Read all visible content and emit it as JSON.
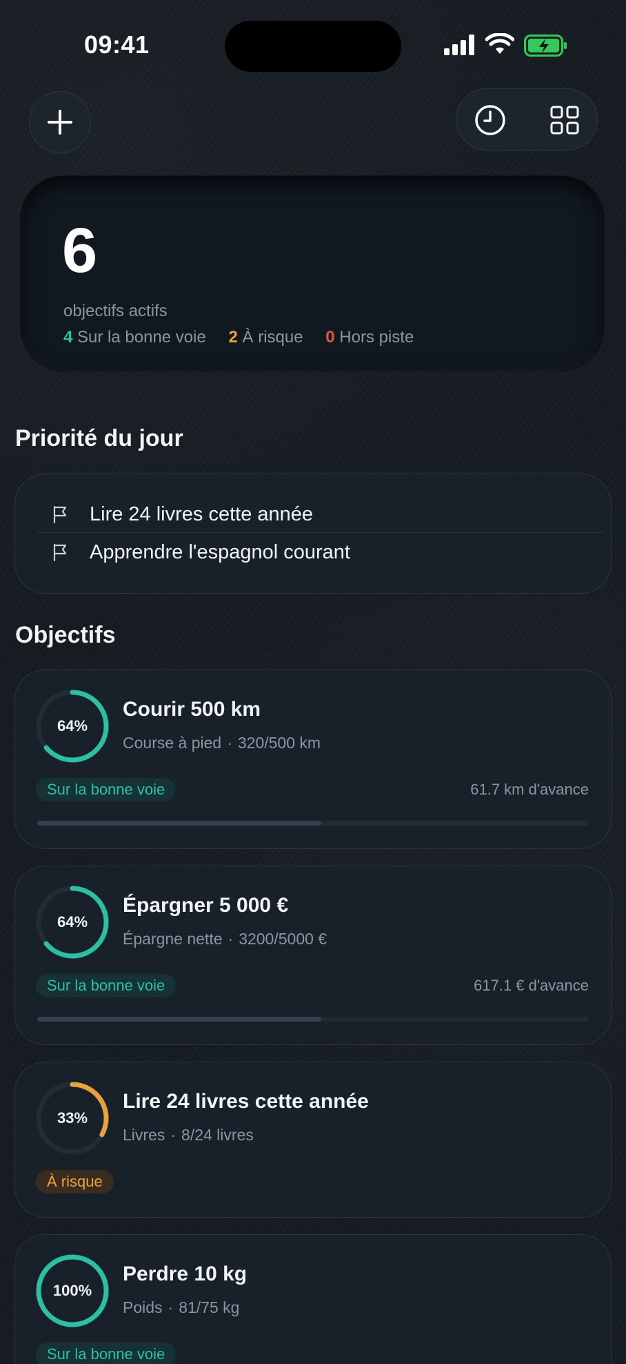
{
  "status_bar": {
    "time": "09:41"
  },
  "summary": {
    "count": "6",
    "label": "objectifs actifs",
    "on_track_count": "4",
    "on_track_label": "Sur la bonne voie",
    "at_risk_count": "2",
    "at_risk_label": "À risque",
    "off_track_count": "0",
    "off_track_label": "Hors piste"
  },
  "priority": {
    "title": "Priorité du jour",
    "items": [
      {
        "label": "Lire 24 livres cette année"
      },
      {
        "label": "Apprendre l'espagnol courant"
      }
    ]
  },
  "objectives": {
    "title": "Objectifs",
    "items": [
      {
        "percent_text": "64%",
        "progress": 0.64,
        "title": "Courir 500 km",
        "category": "Course à pied",
        "amount": "320/500 km",
        "status": "Sur la bonne voie",
        "status_type": "on_track",
        "ahead": "61.7 km d'avance",
        "bar_progress": 0.515
      },
      {
        "percent_text": "64%",
        "progress": 0.64,
        "title": "Épargner 5 000 €",
        "category": "Épargne nette",
        "amount": "3200/5000 €",
        "status": "Sur la bonne voie",
        "status_type": "on_track",
        "ahead": "617.1 € d'avance",
        "bar_progress": 0.515
      },
      {
        "percent_text": "33%",
        "progress": 0.33,
        "title": "Lire 24 livres cette année",
        "category": "Livres",
        "amount": "8/24 livres",
        "status": "À risque",
        "status_type": "at_risk"
      },
      {
        "percent_text": "100%",
        "progress": 1.0,
        "title": "Perdre 10 kg",
        "category": "Poids",
        "amount": "81/75 kg",
        "status": "Sur la bonne voie",
        "status_type": "on_track"
      }
    ]
  },
  "colors": {
    "accent_green": "#2bbfa4",
    "accent_orange": "#e8a33b",
    "accent_red": "#e5533c",
    "card_bg": "#18202a"
  },
  "icons": {
    "add": "plus-icon",
    "history": "clock-icon",
    "grid": "grid-icon",
    "priority_item": "flag-icon"
  }
}
